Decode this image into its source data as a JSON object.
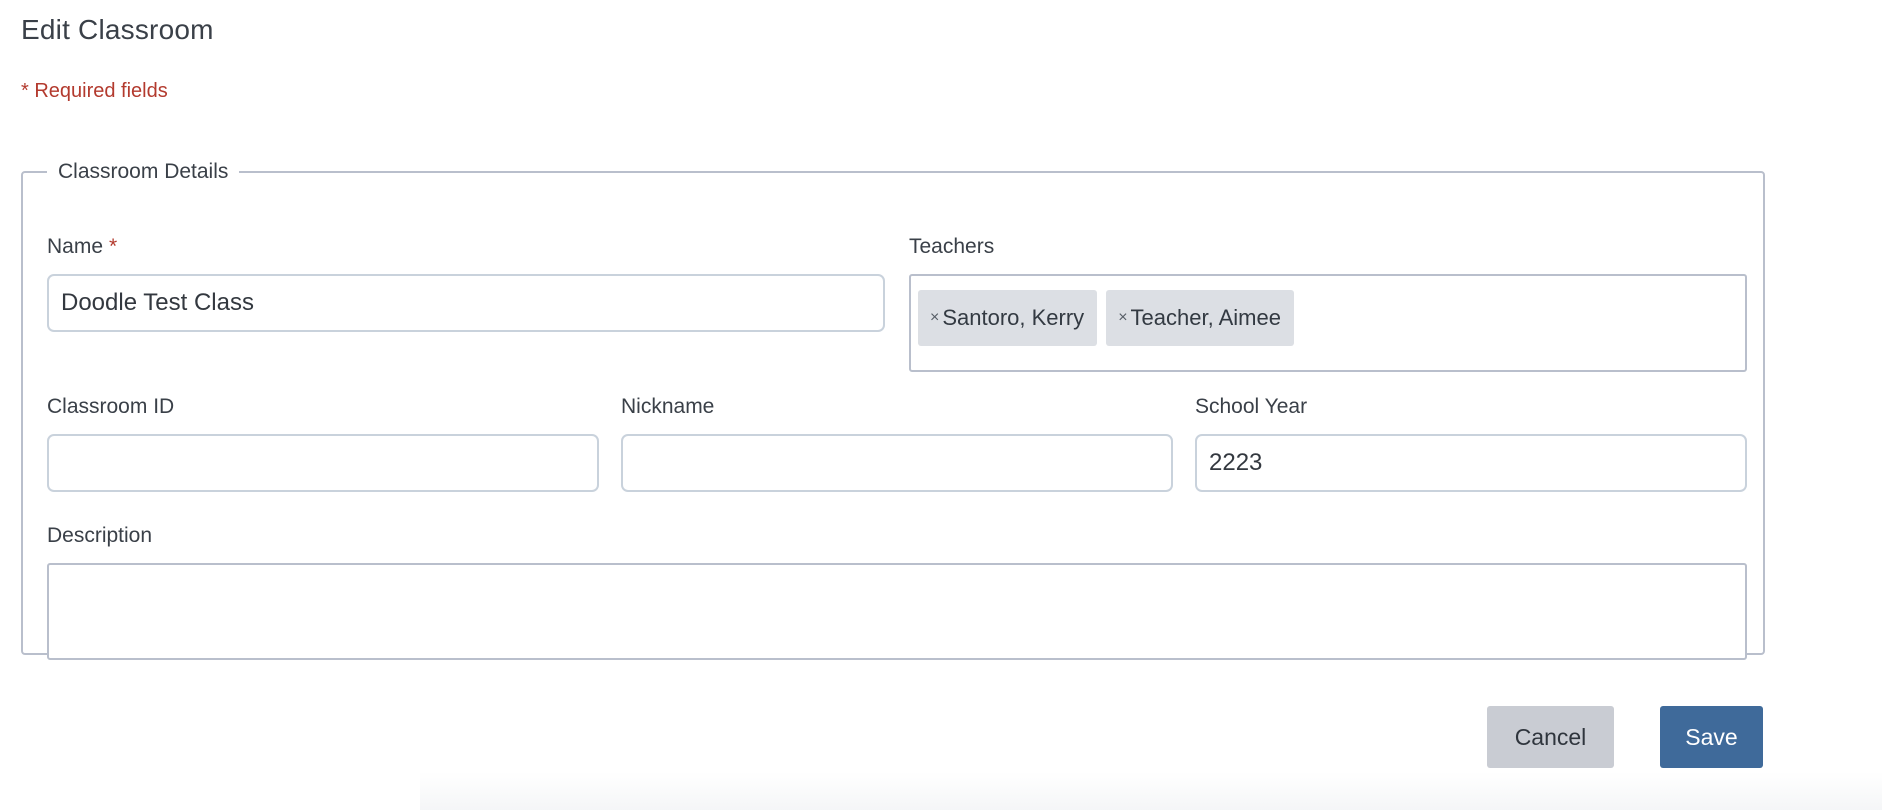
{
  "page": {
    "title": "Edit Classroom",
    "required_note": "* Required fields"
  },
  "fieldset": {
    "legend": "Classroom Details"
  },
  "fields": {
    "name": {
      "label": "Name",
      "required_mark": "*",
      "value": "Doodle Test Class"
    },
    "teachers": {
      "label": "Teachers",
      "remove_glyph": "×",
      "tags": [
        "Santoro, Kerry",
        "Teacher, Aimee"
      ]
    },
    "classroom_id": {
      "label": "Classroom ID",
      "value": ""
    },
    "nickname": {
      "label": "Nickname",
      "value": ""
    },
    "school_year": {
      "label": "School Year",
      "value": "2223"
    },
    "description": {
      "label": "Description",
      "value": ""
    }
  },
  "actions": {
    "cancel_label": "Cancel",
    "save_label": "Save"
  },
  "colors": {
    "required": "#b33a2e",
    "primary_button": "#3f6a9a",
    "secondary_button": "#c9ccd3",
    "tag_background": "#dcdfe4"
  }
}
